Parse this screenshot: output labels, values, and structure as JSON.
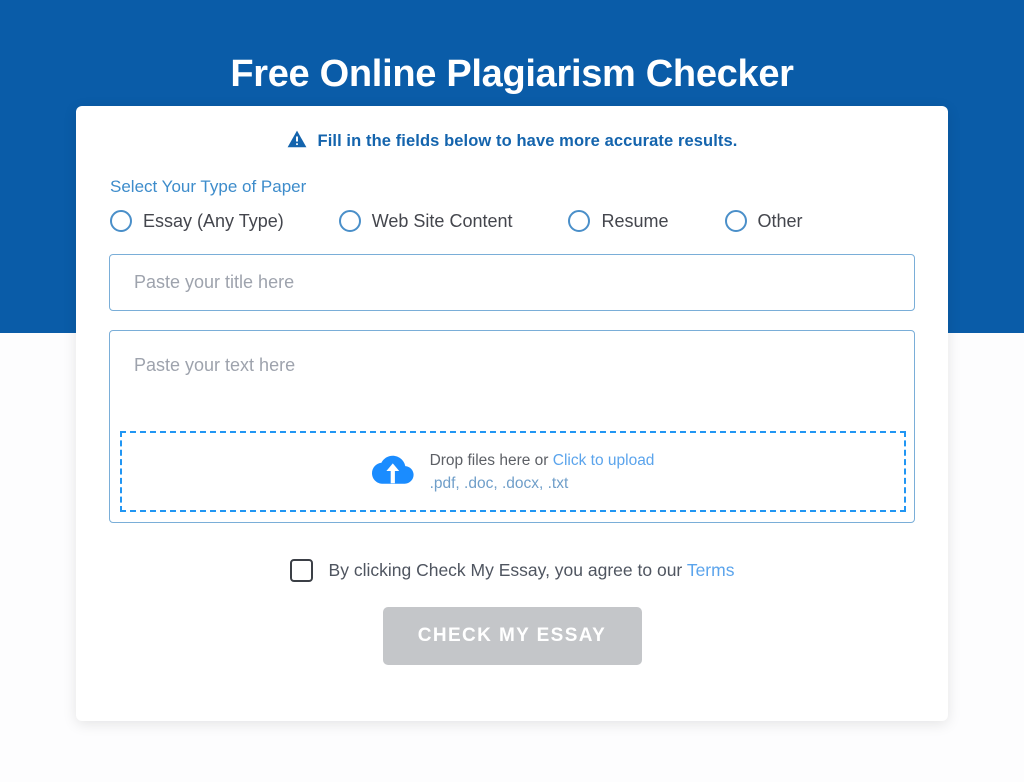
{
  "page": {
    "title": "Free Online Plagiarism Checker",
    "header_bg": "#0a5ca8",
    "body_bg": "#fdfdfe"
  },
  "notice": {
    "icon": "warning-triangle-icon",
    "text": "Fill in the fields below to have more accurate results.",
    "color": "#1464ad"
  },
  "paper_type": {
    "label": "Select Your Type of Paper",
    "options": [
      {
        "label": "Essay (Any Type)",
        "selected": false
      },
      {
        "label": "Web Site Content",
        "selected": false
      },
      {
        "label": "Resume",
        "selected": false
      },
      {
        "label": "Other",
        "selected": false
      }
    ]
  },
  "title_field": {
    "placeholder": "Paste your title here",
    "value": ""
  },
  "text_field": {
    "placeholder": "Paste your text here",
    "value": ""
  },
  "dropzone": {
    "icon": "cloud-upload-icon",
    "prompt": "Drop files here or ",
    "link": "Click to upload",
    "formats": ".pdf, .doc, .docx, .txt",
    "border_color": "#2196f3"
  },
  "terms": {
    "checked": false,
    "text": "By clicking Check My Essay, you agree to our ",
    "link": "Terms"
  },
  "submit": {
    "label": "CHECK MY ESSAY",
    "disabled": true,
    "bg": "#c4c6c9"
  }
}
